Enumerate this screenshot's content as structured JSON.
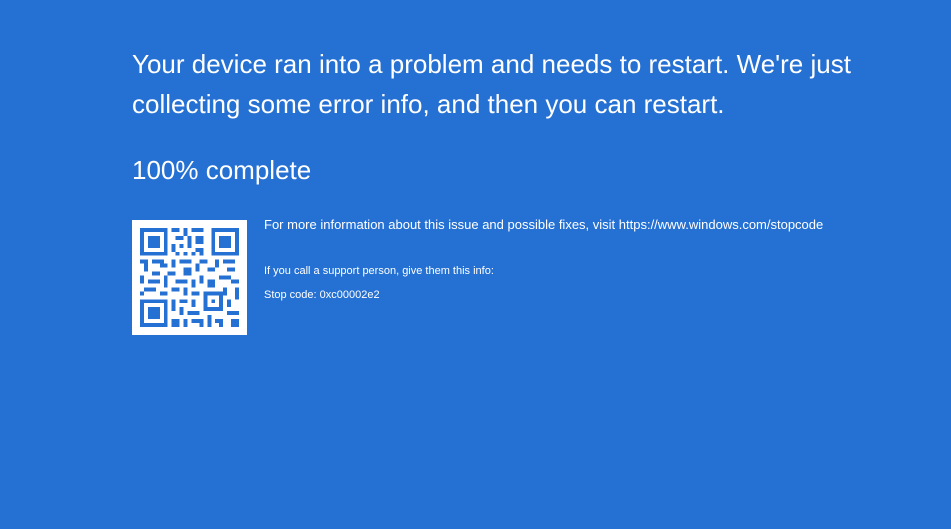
{
  "colors": {
    "background": "#2570d3",
    "text": "#ffffff",
    "qr_background": "#ffffff",
    "qr_module": "#2570d3"
  },
  "message": {
    "line1": "Your device ran into a problem and needs to restart. We're just",
    "line2": "collecting some error info, and then you can restart."
  },
  "progress": {
    "text": "100% complete",
    "percent": 100
  },
  "qr_code": {
    "icon": "qr-code-icon"
  },
  "info": {
    "more_info": "For more information about this issue and possible fixes, visit https://www.windows.com/stopcode",
    "support_person": "If you call a support person, give them this info:",
    "stop_code": "Stop code: 0xc00002e2"
  }
}
